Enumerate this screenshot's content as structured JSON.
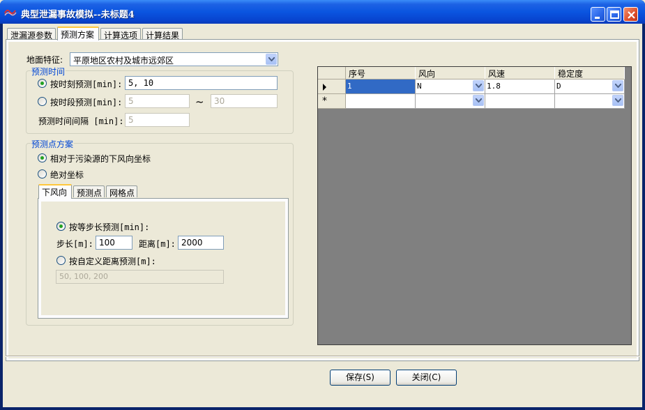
{
  "window": {
    "title": "典型泄漏事故模拟--未标题4"
  },
  "tabs": [
    "泄漏源参数",
    "预测方案",
    "计算选项",
    "计算结果"
  ],
  "left": {
    "terrain_label": "地面特征:",
    "terrain_value": "平原地区农村及城市远郊区",
    "time_group_title": "预测时间",
    "time_point_label": "按时刻预测[min]:",
    "time_point_value": "5, 10",
    "time_range_label": "按时段预测[min]:",
    "time_range_from": "5",
    "tilde": "~",
    "time_range_to": "30",
    "interval_label": "预测时间间隔 [min]:",
    "interval_value": "5",
    "point_group_title": "预测点方案",
    "relative_label": "相对于污染源的下风向坐标",
    "absolute_label": "绝对坐标",
    "subtabs": [
      "下风向",
      "预测点",
      "网格点"
    ],
    "equal_step_label": "按等步长预测[min]:",
    "step_label": "步长[m]:",
    "step_value": "100",
    "distance_label": "距离[m]:",
    "distance_value": "2000",
    "custom_label": "按自定义距离预测[m]:",
    "custom_value": "50, 100, 200"
  },
  "grid": {
    "columns": [
      "序号",
      "风向",
      "风速",
      "稳定度"
    ],
    "rows": [
      {
        "no": "1",
        "dir": "N",
        "speed": "1.8",
        "stability": "D"
      }
    ],
    "new_row_marker": "*"
  },
  "buttons": {
    "save": "保存(S)",
    "close": "关闭(C)"
  },
  "colors": {
    "title_bar": "#0a55e0",
    "group_title": "#0046d5",
    "selected_cell": "#316ac5",
    "radio_dot": "#21a121"
  }
}
